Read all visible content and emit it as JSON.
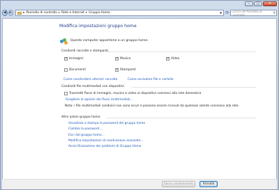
{
  "window": {
    "controls": {
      "minimize": "–",
      "maximize": "□",
      "close": "✕"
    }
  },
  "nav": {
    "back_glyph": "◀",
    "forward_glyph": "▶",
    "breadcrumb": [
      "Pannello di controllo",
      "Rete e Internet",
      "Gruppo Home"
    ],
    "separator": "▸",
    "search_placeholder": "Cerca nel Pannello di controllo"
  },
  "page": {
    "title": "Modifica impostazioni gruppo home",
    "membership_text": "Questo computer appartiene a un gruppo home.",
    "share_section": "Condividi raccolte e stampanti",
    "share_items": [
      {
        "label": "Immagini",
        "checked": true
      },
      {
        "label": "Musica",
        "checked": true
      },
      {
        "label": "Video",
        "checked": true
      },
      {
        "label": "Documenti",
        "checked": false
      },
      {
        "label": "Stampanti",
        "checked": true
      }
    ],
    "share_links": [
      "Come condividere ulteriori raccolte",
      "Come escludere file e cartelle"
    ],
    "media_section": "Condividi file multimediali con dispositivi",
    "media_checkbox": {
      "label": "Trasmetti flussi di immagini, musica e video ai dispositivi connessi alla rete domestica",
      "checked": false
    },
    "media_link": "Scegliere le opzioni dei flussi multimediali...",
    "note": "Nota: i file multimediali condivisi non sono sicuri e possono essere ricevuti da qualsiasi utente connesso alla rete.",
    "other_section": "Altre azioni gruppo home",
    "actions": [
      "Visualizza o stampa la password del gruppo home",
      "Cambia la password...",
      "Esci dal gruppo home...",
      "Modifica impostazioni di condivisione avanzate...",
      "Avvia Risoluzione dei problemi di Gruppo Home"
    ]
  },
  "footer": {
    "save_label": "Salva cambiamenti",
    "cancel_label": "Annulla"
  },
  "colors": {
    "link": "#1d57b9",
    "title": "#1e3e8c"
  }
}
